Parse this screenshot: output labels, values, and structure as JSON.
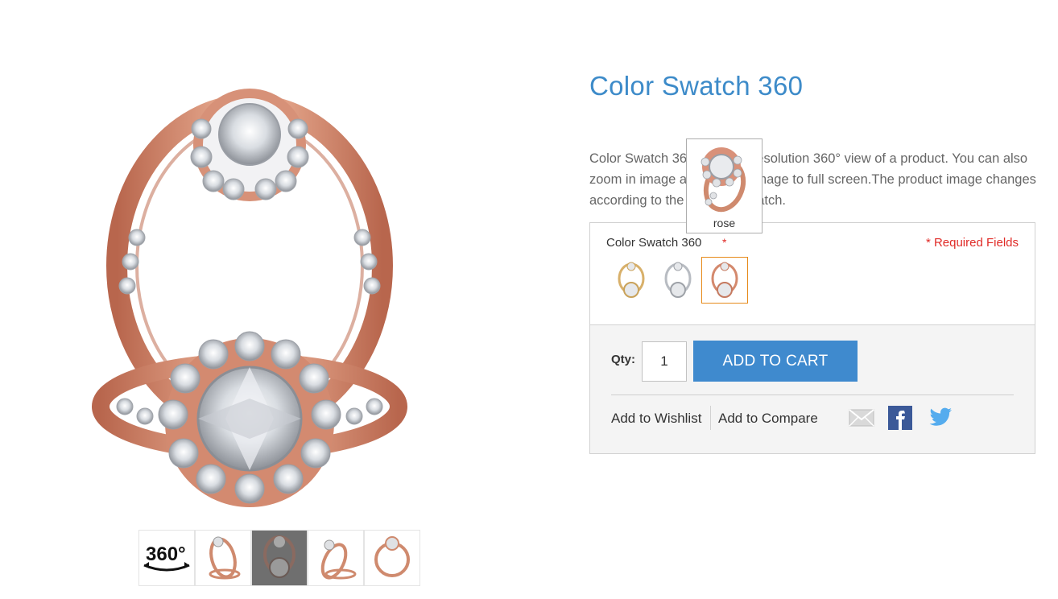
{
  "product": {
    "title": "Color Swatch 360",
    "description": "Color Swatch 360 is a high-resolution 360° view of a product. You can also zoom in image and expand image to full screen.The product image changes according to the selected swatch."
  },
  "gallery": {
    "thumbnails": [
      {
        "name": "360-view",
        "label": "360°"
      },
      {
        "name": "ring-side"
      },
      {
        "name": "ring-front",
        "active": true
      },
      {
        "name": "ring-angle"
      },
      {
        "name": "ring-top"
      }
    ]
  },
  "options": {
    "label": "Color Swatch 360",
    "required_mark": "*",
    "required_note": "* Required Fields",
    "swatches": [
      {
        "name": "gold"
      },
      {
        "name": "white"
      },
      {
        "name": "rose",
        "selected": true
      }
    ],
    "tooltip": "rose"
  },
  "cart": {
    "qty_label": "Qty:",
    "qty_value": "1",
    "add_to_cart": "ADD TO CART",
    "wishlist": "Add to Wishlist",
    "compare": "Add to Compare"
  },
  "colors": {
    "accent": "#3f8ace",
    "title": "#3d8bc9",
    "required": "#e02b27",
    "selected_swatch_border": "#e68a1a",
    "rose_gold": "#d4896d"
  },
  "icons": [
    "email-icon",
    "facebook-icon",
    "twitter-icon",
    "360-icon"
  ]
}
